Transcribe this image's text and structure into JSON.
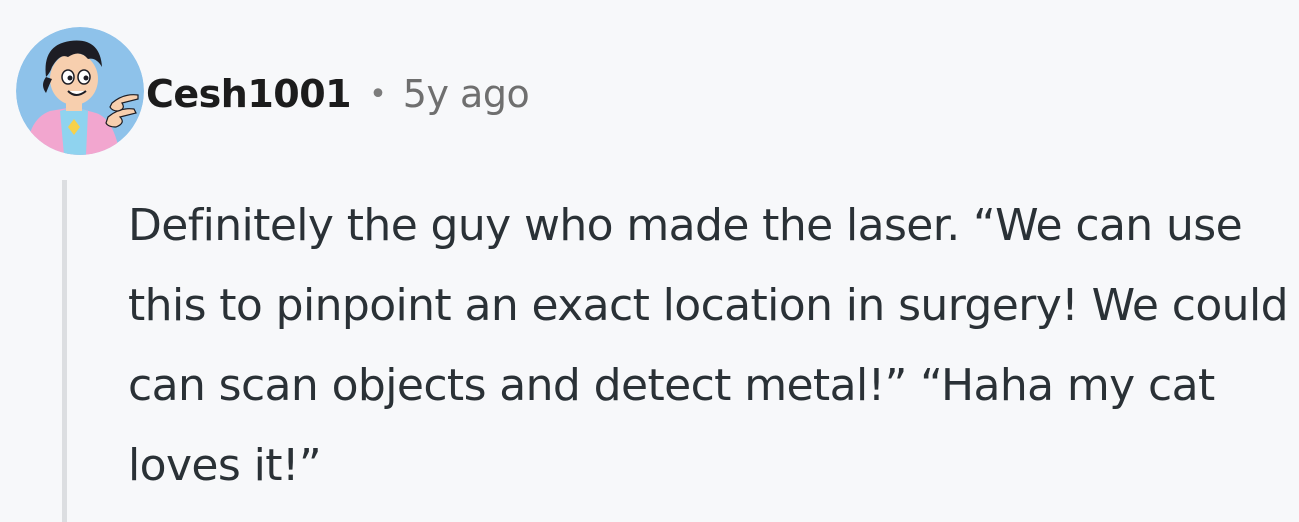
{
  "comment": {
    "author": "Cesh1001",
    "separator": "•",
    "timestamp": "5y ago",
    "text": "Definitely the guy who made the laser. “We can use this to pinpoint an exact location in surgery! We could can scan objects and detect metal!” “Haha my cat loves it!”"
  },
  "colors": {
    "background": "#f7f8fa",
    "thread_line": "#dcdee1",
    "body_text": "#2a3136",
    "meta_text": "#6f6f6f",
    "avatar_bg": "#8ec2ea"
  },
  "icons": {
    "avatar": "cartoon-character-avatar-icon"
  }
}
